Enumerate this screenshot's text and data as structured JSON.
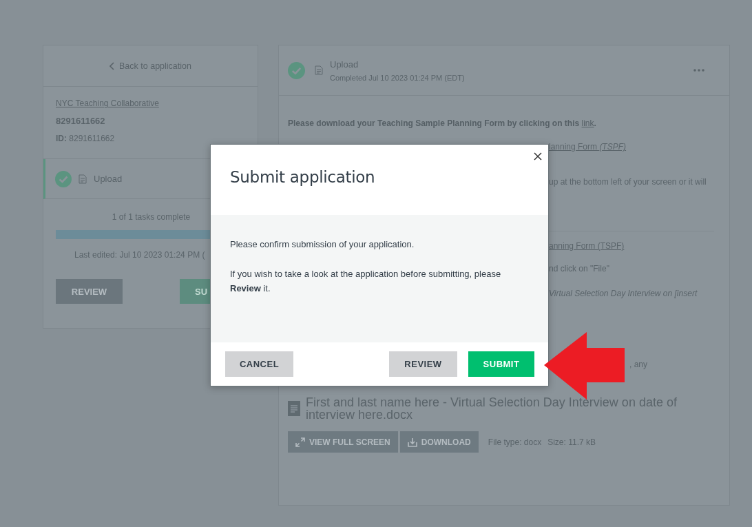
{
  "sidebar": {
    "back_link": "Back to application",
    "organization": "NYC Teaching Collaborative",
    "name": "8291611662",
    "id_label": "ID:",
    "id_value": "8291611662",
    "tasks": [
      {
        "label": "Upload",
        "completed": true,
        "selected": true
      }
    ],
    "progress": {
      "text": "1 of 1 tasks complete",
      "level": 1
    },
    "last_edited": "Last edited: Jul 10 2023 01:24 PM (",
    "buttons": [
      {
        "label": "REVIEW",
        "kind": "secondary"
      },
      {
        "label": "SU",
        "kind": "primary"
      }
    ]
  },
  "task_panel": {
    "title": "Upload",
    "completed": true,
    "subtitle": "Completed Jul 10 2023 01:24 PM (EDT)",
    "intro": {
      "text": "Please download your Teaching Sample Planning Form by clicking on this",
      "link": "link",
      "after": "."
    },
    "fragments": [
      {
        "kind": "link",
        "text": "lanning Form *(TSPF)*"
      },
      {
        "kind": "plain",
        "text": "up at the bottom left of your screen or it will"
      },
      {
        "kind": "link",
        "text": "anning Form (TSPF)"
      },
      {
        "kind": "plain",
        "text": "nd click on \"File\""
      },
      {
        "kind": "italic",
        "text": "Virtual Selection Day Interview on [insert"
      },
      {
        "kind": "plain",
        "text": ", any"
      }
    ],
    "file": {
      "name": "First and last name here - Virtual Selection Day Interview on date of interview here.docx",
      "buttons": [
        {
          "label": "VIEW FULL SCREEN",
          "kind": "expand"
        },
        {
          "label": "DOWNLOAD",
          "kind": "download"
        }
      ],
      "file_type": "File type: docx",
      "size": "Size: 11.7 kB"
    }
  },
  "dialog": {
    "title": "Submit application",
    "message": "Please confirm submission of your application.",
    "note": "If you wish to take a look at the application before submitting, please **Review** it.",
    "buttons": [
      {
        "label": "CANCEL",
        "kind": "secondary"
      },
      {
        "label": "REVIEW",
        "kind": "secondary"
      },
      {
        "label": "SUBMIT",
        "kind": "primary"
      }
    ]
  }
}
